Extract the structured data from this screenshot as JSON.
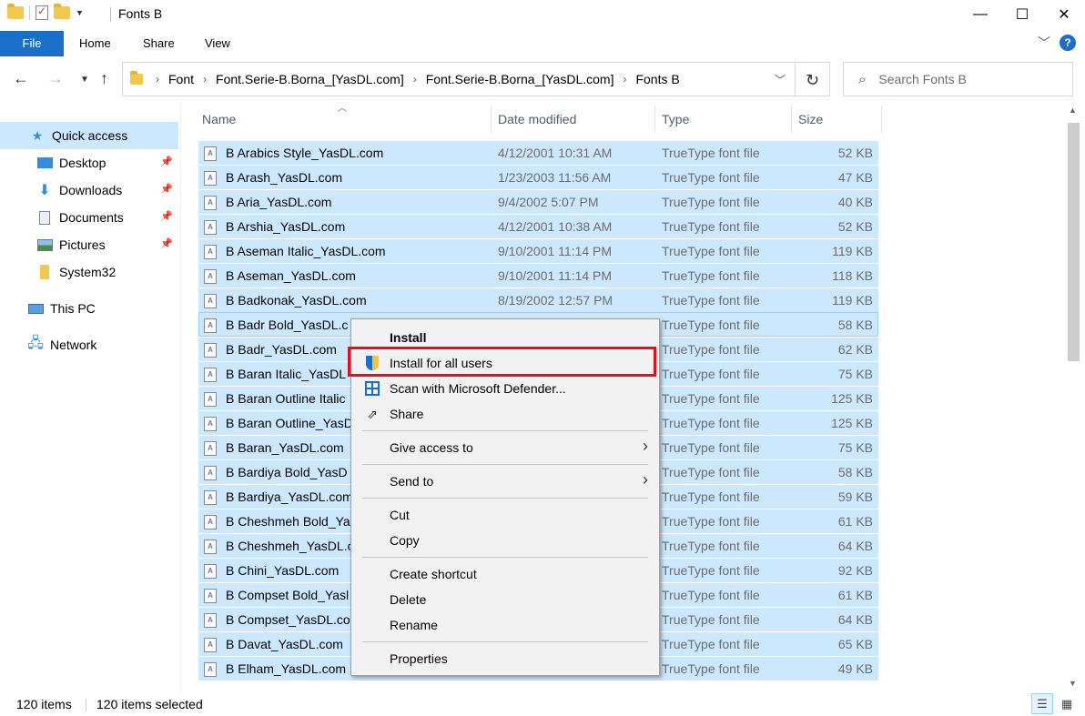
{
  "window": {
    "title": "Fonts B",
    "controls": {
      "minimize": "—",
      "maximize": "☐",
      "close": "✕"
    }
  },
  "ribbon": {
    "tabs": [
      "File",
      "Home",
      "Share",
      "View"
    ]
  },
  "address": {
    "crumbs": [
      "Font",
      "Font.Serie-B.Borna_[YasDL.com]",
      "Font.Serie-B.Borna_[YasDL.com]",
      "Fonts B"
    ]
  },
  "search": {
    "placeholder": "Search Fonts B"
  },
  "sidebar": {
    "items": [
      {
        "label": "Quick access",
        "icon": "star-icon",
        "pinned": false
      },
      {
        "label": "Desktop",
        "icon": "desktop-icon",
        "pinned": true
      },
      {
        "label": "Downloads",
        "icon": "download-arrow-icon",
        "pinned": true
      },
      {
        "label": "Documents",
        "icon": "documents-icon",
        "pinned": true
      },
      {
        "label": "Pictures",
        "icon": "pictures-icon",
        "pinned": true
      },
      {
        "label": "System32",
        "icon": "folder-icon",
        "pinned": false
      },
      {
        "label": "This PC",
        "icon": "computer-icon",
        "pinned": false
      },
      {
        "label": "Network",
        "icon": "network-icon",
        "pinned": false
      }
    ]
  },
  "columns": {
    "name": "Name",
    "date": "Date modified",
    "type": "Type",
    "size": "Size"
  },
  "files": [
    {
      "name": "B Arabics Style_YasDL.com",
      "date": "4/12/2001 10:31 AM",
      "type": "TrueType font file",
      "size": "52 KB"
    },
    {
      "name": "B Arash_YasDL.com",
      "date": "1/23/2003 11:56 AM",
      "type": "TrueType font file",
      "size": "47 KB"
    },
    {
      "name": "B Aria_YasDL.com",
      "date": "9/4/2002 5:07 PM",
      "type": "TrueType font file",
      "size": "40 KB"
    },
    {
      "name": "B Arshia_YasDL.com",
      "date": "4/12/2001 10:38 AM",
      "type": "TrueType font file",
      "size": "52 KB"
    },
    {
      "name": "B Aseman Italic_YasDL.com",
      "date": "9/10/2001 11:14 PM",
      "type": "TrueType font file",
      "size": "119 KB"
    },
    {
      "name": "B Aseman_YasDL.com",
      "date": "9/10/2001 11:14 PM",
      "type": "TrueType font file",
      "size": "118 KB"
    },
    {
      "name": "B Badkonak_YasDL.com",
      "date": "8/19/2002 12:57 PM",
      "type": "TrueType font file",
      "size": "119 KB"
    },
    {
      "name": "B Badr Bold_YasDL.c",
      "date": "",
      "type": "TrueType font file",
      "size": "58 KB"
    },
    {
      "name": "B Badr_YasDL.com",
      "date": "",
      "type": "TrueType font file",
      "size": "62 KB"
    },
    {
      "name": "B Baran Italic_YasDL",
      "date": "",
      "type": "TrueType font file",
      "size": "75 KB"
    },
    {
      "name": "B Baran Outline Italic",
      "date": "",
      "type": "TrueType font file",
      "size": "125 KB"
    },
    {
      "name": "B Baran Outline_YasD",
      "date": "",
      "type": "TrueType font file",
      "size": "125 KB"
    },
    {
      "name": "B Baran_YasDL.com",
      "date": "",
      "type": "TrueType font file",
      "size": "75 KB"
    },
    {
      "name": "B Bardiya Bold_YasD",
      "date": "",
      "type": "TrueType font file",
      "size": "58 KB"
    },
    {
      "name": "B Bardiya_YasDL.com",
      "date": "",
      "type": "TrueType font file",
      "size": "59 KB"
    },
    {
      "name": "B Cheshmeh Bold_Ya",
      "date": "",
      "type": "TrueType font file",
      "size": "61 KB"
    },
    {
      "name": "B Cheshmeh_YasDL.c",
      "date": "",
      "type": "TrueType font file",
      "size": "64 KB"
    },
    {
      "name": "B Chini_YasDL.com",
      "date": "",
      "type": "TrueType font file",
      "size": "92 KB"
    },
    {
      "name": "B Compset Bold_Yasl",
      "date": "",
      "type": "TrueType font file",
      "size": "61 KB"
    },
    {
      "name": "B Compset_YasDL.co",
      "date": "",
      "type": "TrueType font file",
      "size": "64 KB"
    },
    {
      "name": "B Davat_YasDL.com",
      "date": "",
      "type": "TrueType font file",
      "size": "65 KB"
    },
    {
      "name": "B Elham_YasDL.com",
      "date": "",
      "type": "TrueType font file",
      "size": "49 KB"
    }
  ],
  "context_menu": {
    "items": [
      {
        "label": "Install",
        "bold": true,
        "icon": "",
        "submenu": false
      },
      {
        "label": "Install for all users",
        "bold": false,
        "icon": "uac-shield-icon",
        "submenu": false
      },
      {
        "label": "Scan with Microsoft Defender...",
        "bold": false,
        "icon": "defender-icon",
        "submenu": false
      },
      {
        "label": "Share",
        "bold": false,
        "icon": "share-icon",
        "submenu": false
      },
      {
        "label": "Give access to",
        "bold": false,
        "icon": "",
        "submenu": true
      },
      {
        "label": "Send to",
        "bold": false,
        "icon": "",
        "submenu": true
      },
      {
        "label": "Cut",
        "bold": false,
        "icon": "",
        "submenu": false
      },
      {
        "label": "Copy",
        "bold": false,
        "icon": "",
        "submenu": false
      },
      {
        "label": "Create shortcut",
        "bold": false,
        "icon": "",
        "submenu": false
      },
      {
        "label": "Delete",
        "bold": false,
        "icon": "",
        "submenu": false
      },
      {
        "label": "Rename",
        "bold": false,
        "icon": "",
        "submenu": false
      },
      {
        "label": "Properties",
        "bold": false,
        "icon": "",
        "submenu": false
      }
    ],
    "highlighted": "Install for all users",
    "highlight_color": "#e3101b"
  },
  "status": {
    "item_count": "120 items",
    "selected_count": "120 items selected"
  },
  "colors": {
    "accent": "#1a6fc9",
    "selection": "#cce8ff"
  }
}
